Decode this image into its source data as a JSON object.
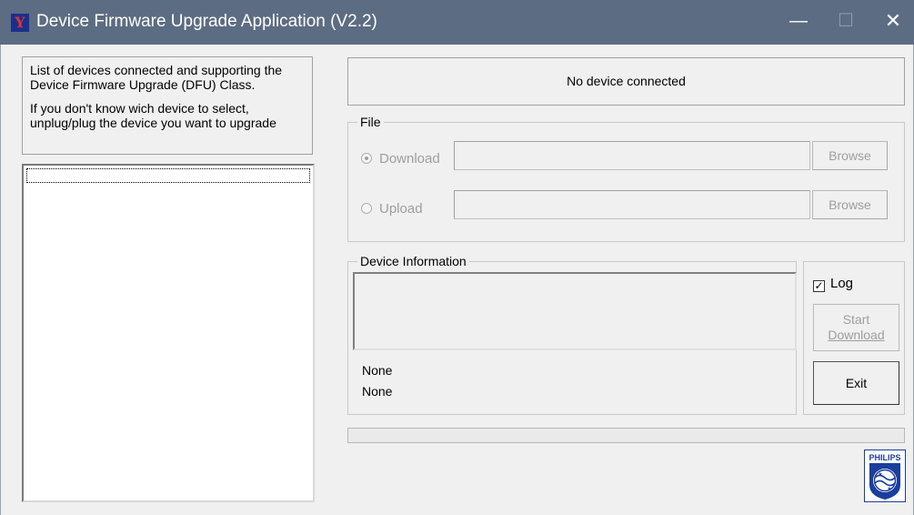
{
  "window": {
    "title": "Device Firmware Upgrade Application (V2.2)",
    "minimize_glyph": "—",
    "maximize_glyph": "☐",
    "close_glyph": "✕"
  },
  "device_list_help": {
    "line1": "List of devices connected and supporting the Device Firmware Upgrade (DFU) Class.",
    "line2": "If you don't know wich device to select, unplug/plug the device you want to upgrade"
  },
  "device_list": {
    "items": []
  },
  "status": {
    "text": "No device connected"
  },
  "file_group": {
    "legend": "File",
    "download_label": "Download",
    "upload_label": "Upload",
    "download_path": "",
    "upload_path": "",
    "browse_label": "Browse",
    "selected": "Download"
  },
  "device_info": {
    "legend": "Device Information",
    "line1": "None",
    "line2": "None"
  },
  "actions": {
    "log_label": "Log",
    "log_checked": true,
    "start_line1": "Start",
    "start_line2": "Download",
    "exit_label": "Exit"
  },
  "progress": {
    "value": 0
  },
  "logo": {
    "text": "PHILIPS",
    "icon": "philips-shield-logo"
  },
  "colors": {
    "titlebar": "#5c6c82",
    "window_bg": "#f0f0f0",
    "disabled_text": "#9e9e9e",
    "logo_blue": "#1a3e9c"
  }
}
